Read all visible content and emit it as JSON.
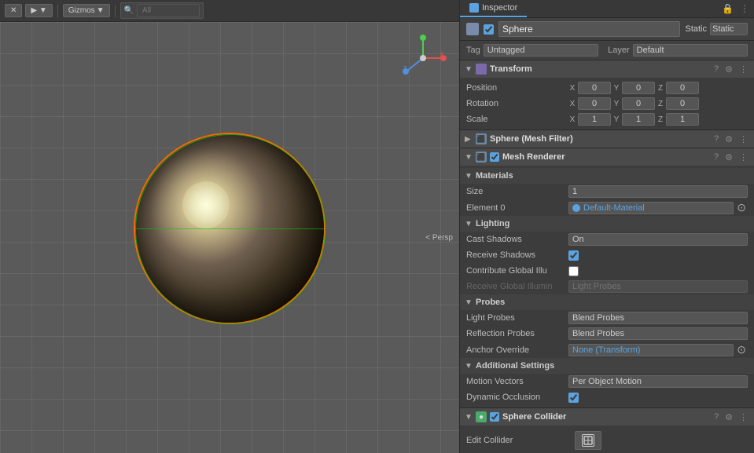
{
  "viewport": {
    "toolbar": {
      "move_tool": "✕",
      "camera_btn": "📷",
      "gizmos_btn": "Gizmos",
      "all_btn": "All",
      "search_placeholder": "All",
      "persp_label": "< Persp"
    }
  },
  "inspector": {
    "tab_label": "Inspector",
    "tab_lock_icon": "🔒",
    "obj_name": "Sphere",
    "static_label": "Static",
    "tag_label": "Tag",
    "tag_value": "Untagged",
    "layer_label": "Layer",
    "layer_value": "Default",
    "components": {
      "transform": {
        "title": "Transform",
        "position_label": "Position",
        "pos_x": "0",
        "pos_y": "0",
        "pos_z": "0",
        "rotation_label": "Rotation",
        "rot_x": "0",
        "rot_y": "0",
        "rot_z": "0",
        "scale_label": "Scale",
        "scale_x": "1",
        "scale_y": "1",
        "scale_z": "1"
      },
      "mesh_filter": {
        "title": "Sphere (Mesh Filter)"
      },
      "mesh_renderer": {
        "title": "Mesh Renderer",
        "materials_section": "Materials",
        "size_label": "Size",
        "size_value": "1",
        "element0_label": "Element 0",
        "element0_value": "Default-Material",
        "lighting_section": "Lighting",
        "cast_shadows_label": "Cast Shadows",
        "cast_shadows_value": "On",
        "receive_shadows_label": "Receive Shadows",
        "contribute_gi_label": "Contribute Global Illu",
        "receive_gi_label": "Receive Global Illumin",
        "receive_gi_value": "Light Probes",
        "probes_section": "Probes",
        "light_probes_label": "Light Probes",
        "light_probes_value": "Blend Probes",
        "reflection_probes_label": "Reflection Probes",
        "reflection_probes_value": "Blend Probes",
        "anchor_override_label": "Anchor Override",
        "anchor_override_value": "None (Transform)",
        "additional_section": "Additional Settings",
        "motion_vectors_label": "Motion Vectors",
        "motion_vectors_value": "Per Object Motion",
        "dynamic_occlusion_label": "Dynamic Occlusion"
      },
      "sphere_collider": {
        "title": "Sphere Collider",
        "edit_collider_label": "Edit Collider"
      }
    }
  }
}
